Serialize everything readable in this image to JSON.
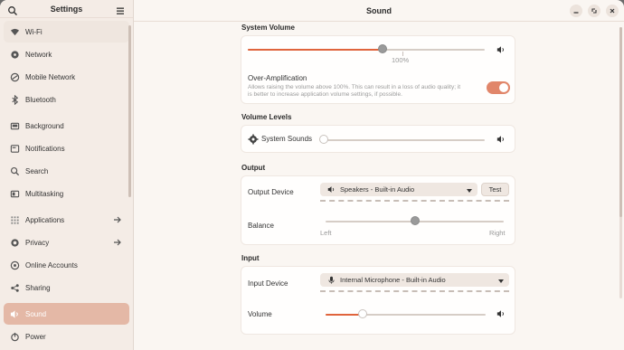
{
  "sidebar": {
    "title": "Settings",
    "items": [
      {
        "label": "Wi-Fi",
        "icon": "wifi-icon"
      },
      {
        "label": "Network",
        "icon": "network-icon"
      },
      {
        "label": "Mobile Network",
        "icon": "mobile-network-icon"
      },
      {
        "label": "Bluetooth",
        "icon": "bluetooth-icon"
      },
      {
        "label": "Background",
        "icon": "background-icon"
      },
      {
        "label": "Notifications",
        "icon": "notifications-icon"
      },
      {
        "label": "Search",
        "icon": "search-icon"
      },
      {
        "label": "Multitasking",
        "icon": "multitasking-icon"
      },
      {
        "label": "Applications",
        "icon": "applications-icon"
      },
      {
        "label": "Privacy",
        "icon": "privacy-icon"
      },
      {
        "label": "Online Accounts",
        "icon": "online-accounts-icon"
      },
      {
        "label": "Sharing",
        "icon": "sharing-icon"
      },
      {
        "label": "Sound",
        "icon": "sound-icon"
      },
      {
        "label": "Power",
        "icon": "power-icon"
      }
    ]
  },
  "header": {
    "title": "Sound"
  },
  "system_volume": {
    "title": "System Volume",
    "level_percent": 57,
    "mark_label": "100%",
    "over_amp_title": "Over-Amplification",
    "over_amp_desc1": "Allows raising the volume above 100%. This can result in a loss of audio quality; it",
    "over_amp_desc2": "is better to increase application volume settings, if possible.",
    "over_amp_enabled": true
  },
  "volume_levels": {
    "title": "Volume Levels",
    "system_sounds_label": "System Sounds",
    "system_sounds_level_percent": 0
  },
  "output": {
    "title": "Output",
    "device_label": "Output Device",
    "device_value": "Speakers - Built-in Audio",
    "test_label": "Test",
    "balance_label": "Balance",
    "left_label": "Left",
    "right_label": "Right",
    "balance_percent": 50
  },
  "input": {
    "title": "Input",
    "device_label": "Input Device",
    "device_value": "Internal Microphone - Built-in Audio",
    "volume_label": "Volume",
    "volume_percent": 23
  },
  "colors": {
    "accent": "#e0643c",
    "active_sidebar": "#e4b8a6"
  }
}
